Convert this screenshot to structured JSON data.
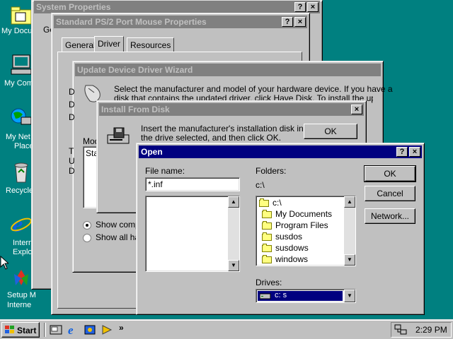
{
  "desktop": {
    "icons": [
      {
        "label": "My Docu",
        "icon": "folder-documents-icon"
      },
      {
        "label": "My Com",
        "icon": "computer-icon"
      },
      {
        "label": "My Net",
        "label2": "Place",
        "icon": "network-icon"
      },
      {
        "label": "Recycle",
        "icon": "recycle-bin-icon"
      },
      {
        "label": "Intern",
        "label2": "Explo",
        "icon": "internet-explorer-icon"
      },
      {
        "label": "Setup M",
        "label2": "Interne",
        "icon": "setup-msn-icon"
      }
    ]
  },
  "system_properties": {
    "title": "System Properties",
    "tab_partial": "Ge"
  },
  "mouse_properties": {
    "title": "Standard PS/2 Port Mouse Properties",
    "tabs": [
      "General",
      "Driver",
      "Resources"
    ]
  },
  "wizard": {
    "title": "Update Device Driver Wizard",
    "text_line1": "Select the manufacturer and model of your hardware device. If you have a",
    "text_line2": "disk that contains the updated driver, click Have Disk. To install the updated",
    "partial_model_label": "Mod",
    "partial_list_item": "Star",
    "radio_show_compatible": "Show compa",
    "radio_show_all": "Show all ha",
    "partial_letters": [
      "D",
      "D",
      "D",
      "T",
      "U",
      "D"
    ]
  },
  "install_from_disk": {
    "title": "Install From Disk",
    "text_line1": "Insert the manufacturer's installation disk into",
    "text_line2": "the drive selected, and then click OK.",
    "ok_label": "OK"
  },
  "open_dialog": {
    "title": "Open",
    "file_name_label": "File name:",
    "file_name_value": "*.inf",
    "folders_label": "Folders:",
    "current_path": "c:\\",
    "folders": [
      "c:\\",
      "My Documents",
      "Program Files",
      "susdos",
      "susdows",
      "windows"
    ],
    "drives_label": "Drives:",
    "drive_value": "c: s",
    "ok_label": "OK",
    "cancel_label": "Cancel",
    "network_label": "Network..."
  },
  "taskbar": {
    "start_label": "Start",
    "quick_launch": [
      "desktop-icon",
      "internet-explorer-icon",
      "channels-icon",
      "media-icon"
    ],
    "overflow": "»",
    "clock": "2:29 PM"
  },
  "colors": {
    "desktop": "#008080",
    "active_title": "#000080",
    "inactive_title": "#808080",
    "selection": "#000080"
  }
}
